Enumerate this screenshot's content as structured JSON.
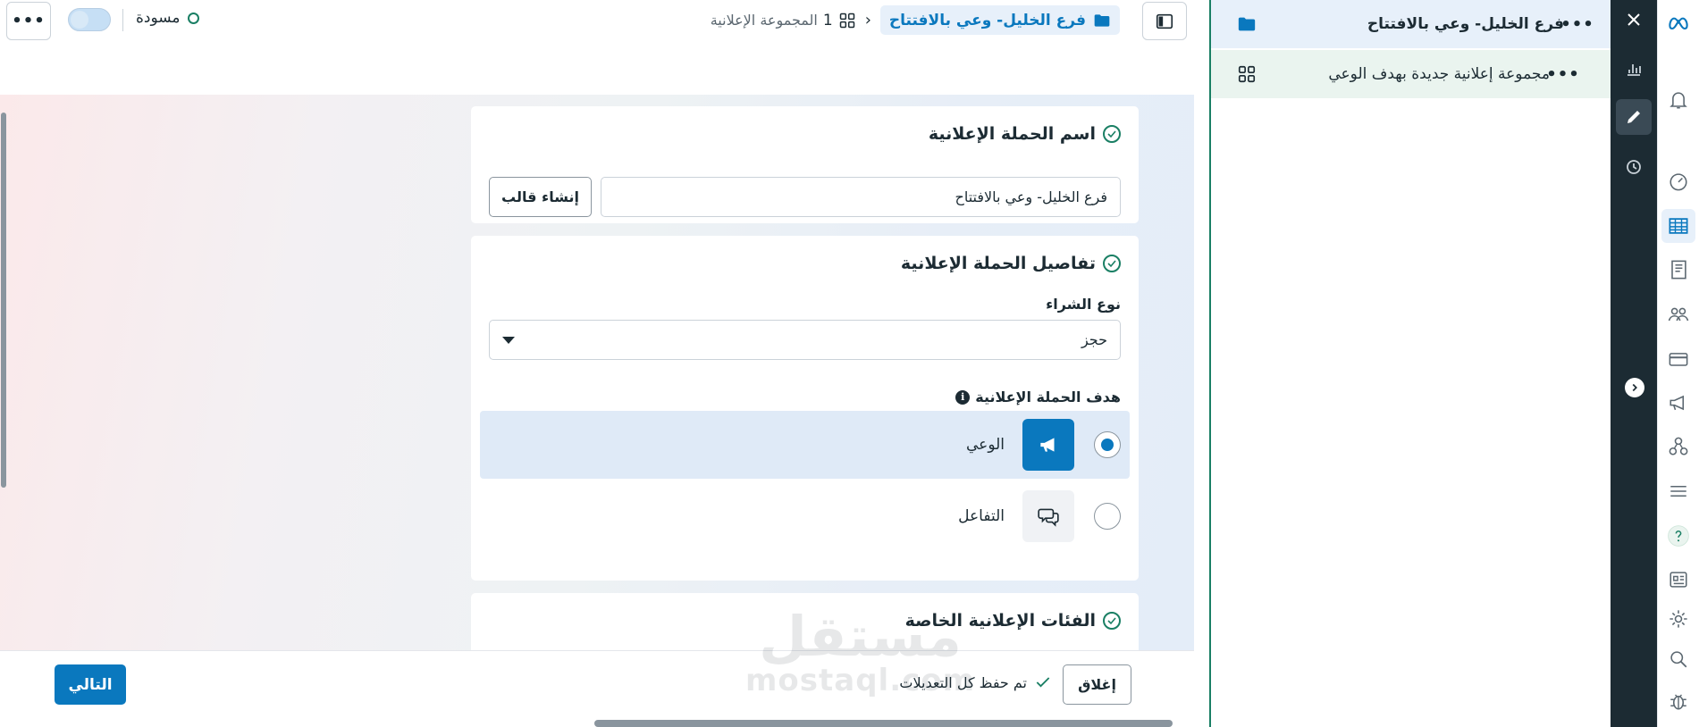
{
  "header": {
    "status_text": "مسودة",
    "campaign_crumb": "فرع الخليل- وعي بالافتتاح",
    "adset_count": "1",
    "adset_crumb": "المجموعة الإعلانية"
  },
  "tree": {
    "campaign_label": "فرع الخليل- وعي بالافتتاح",
    "adset_label": "مجموعة إعلانية جديدة بهدف الوعي"
  },
  "campaign_name_card": {
    "title": "اسم الحملة الإعلانية",
    "name_value": "فرع الخليل- وعي بالافتتاح",
    "create_template_label": "إنشاء قالب"
  },
  "campaign_details_card": {
    "title": "تفاصيل الحملة الإعلانية",
    "buying_type_label": "نوع الشراء",
    "buying_type_value": "حجز",
    "objective_label": "هدف الحملة الإعلانية",
    "objectives": [
      {
        "label": "الوعي",
        "selected": true,
        "icon": "megaphone-icon"
      },
      {
        "label": "التفاعل",
        "selected": false,
        "icon": "chat-bubbles-icon"
      }
    ]
  },
  "special_ad_categories_card": {
    "title": "الفئات الإعلانية الخاصة"
  },
  "footer": {
    "next_label": "التالي",
    "close_label": "إغلاق",
    "saved_text": "تم حفظ كل التعديلات"
  },
  "watermark": {
    "arabic": "مستقل",
    "latin": "mostaql.com"
  },
  "colors": {
    "accent": "#0a78be",
    "success": "#1a7f64",
    "dark_strip": "#1c2b33",
    "selected_row": "#e7f0fa"
  }
}
